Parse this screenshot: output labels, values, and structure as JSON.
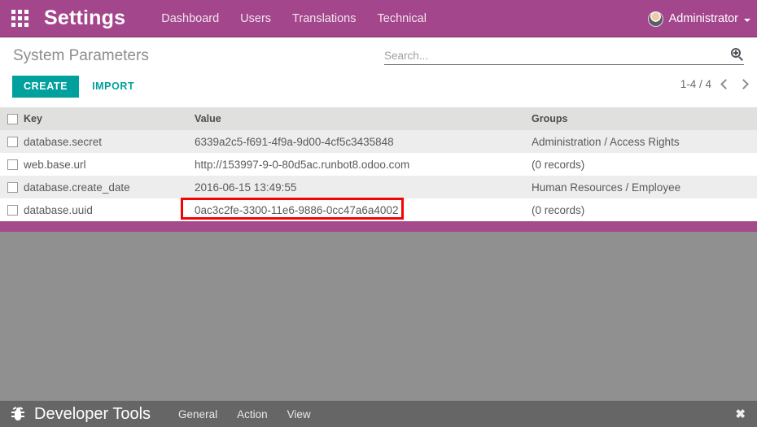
{
  "navbar": {
    "apps_icon": "apps-grid-icon",
    "brand": "Settings",
    "menu": [
      {
        "label": "Dashboard"
      },
      {
        "label": "Users"
      },
      {
        "label": "Translations"
      },
      {
        "label": "Technical"
      }
    ],
    "user": {
      "name": "Administrator",
      "avatar_icon": "user-avatar",
      "caret_icon": "chevron-down-icon"
    },
    "colors": {
      "background": "#a3468c",
      "text": "#ffffff"
    }
  },
  "control_panel": {
    "title": "System Parameters",
    "buttons": {
      "create": "CREATE",
      "import": "IMPORT"
    },
    "create_color": "#00a09d",
    "search": {
      "value": "",
      "placeholder": "Search...",
      "icon": "search-zoom-in-icon"
    },
    "pager": {
      "count": "1-4 / 4",
      "prev_icon": "chevron-left-icon",
      "next_icon": "chevron-right-icon"
    }
  },
  "list": {
    "select_all_icon": "checkbox-unchecked",
    "columns": [
      "Key",
      "Value",
      "Groups"
    ],
    "rows": [
      {
        "key": "database.secret",
        "value": "6339a2c5-f691-4f9a-9d00-4cf5c3435848",
        "groups": "Administration / Access Rights"
      },
      {
        "key": "web.base.url",
        "value": "http://153997-9-0-80d5ac.runbot8.odoo.com",
        "groups": "(0 records)"
      },
      {
        "key": "database.create_date",
        "value": "2016-06-15 13:49:55",
        "groups": "Human Resources / Employee"
      },
      {
        "key": "database.uuid",
        "value": "0ac3c2fe-3300-11e6-9886-0cc47a6a4002",
        "groups": "(0 records)"
      }
    ]
  },
  "annotation": {
    "highlight_color": "#f30303",
    "target": "database.uuid value cell"
  },
  "developer_tools": {
    "bug_icon": "bug-icon",
    "title": "Developer Tools",
    "menu": [
      {
        "label": "General"
      },
      {
        "label": "Action"
      },
      {
        "label": "View"
      }
    ],
    "close_icon": "✖",
    "background": "#666666"
  }
}
